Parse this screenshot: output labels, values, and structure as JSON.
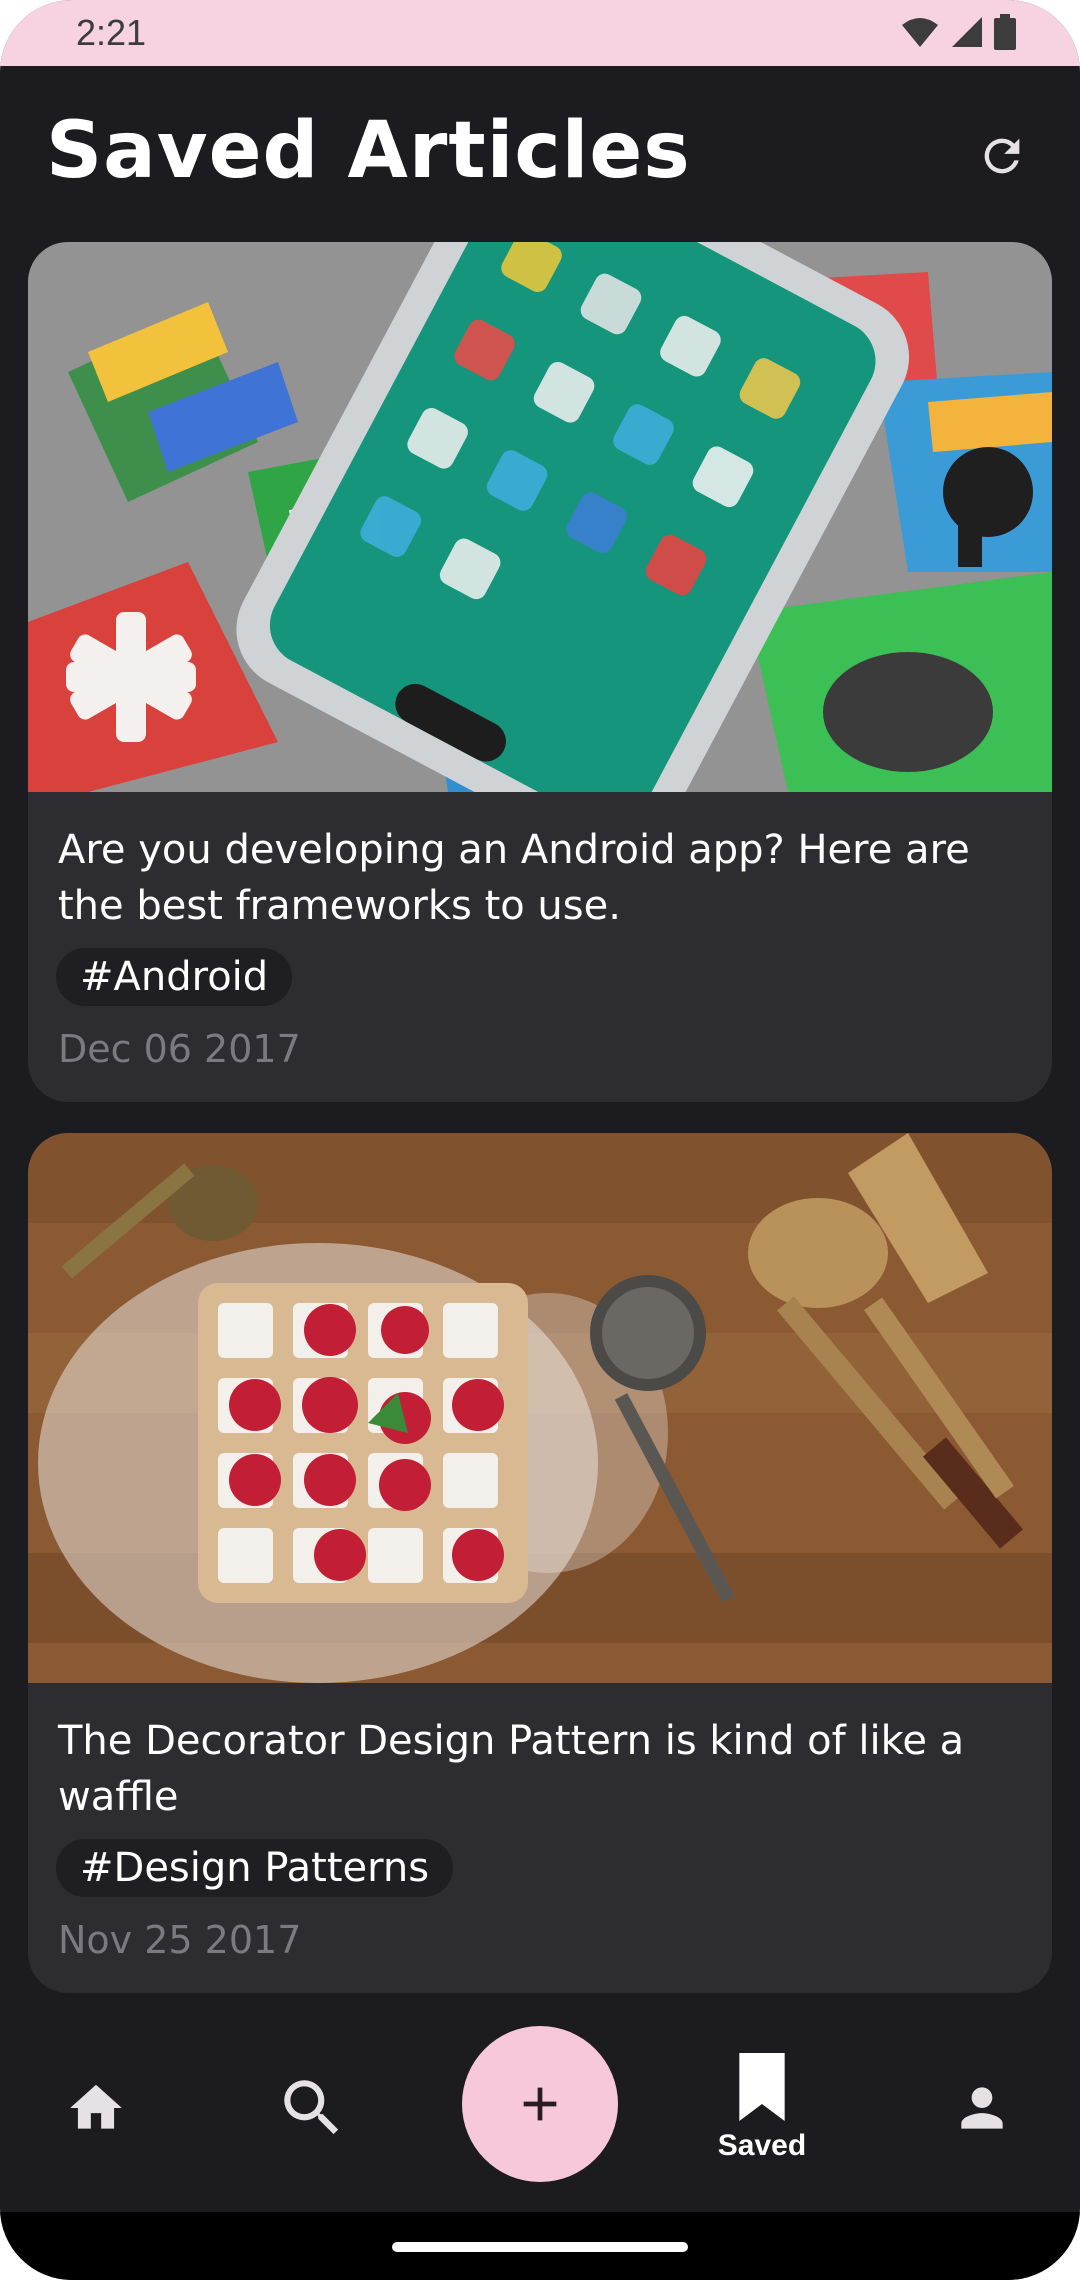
{
  "status_bar": {
    "time": "2:21",
    "icons": [
      "wifi-icon",
      "signal-icon",
      "battery-icon"
    ]
  },
  "header": {
    "title": "Saved Articles",
    "refresh_icon": "refresh-icon"
  },
  "articles": [
    {
      "title": "Are you developing an Android app? Here are the best frameworks to use.",
      "tag": "#Android",
      "date": "Dec 06 2017",
      "image": "smartphone-with-app-icons"
    },
    {
      "title": "The Decorator Design Pattern is kind of like a waffle",
      "tag": "#Design Patterns",
      "date": "Nov 25 2017",
      "image": "waffle-with-raspberries"
    }
  ],
  "bottom_nav": {
    "items": [
      {
        "icon": "home-icon",
        "label": ""
      },
      {
        "icon": "search-icon",
        "label": ""
      },
      {
        "icon": "add-icon",
        "label": ""
      },
      {
        "icon": "bookmark-icon",
        "label": "Saved"
      },
      {
        "icon": "profile-icon",
        "label": ""
      }
    ],
    "active_index": 3
  },
  "colors": {
    "background": "#1c1b1f",
    "card": "#2d2c31",
    "accent": "#f7c8db",
    "status_bar": "#f7d3e1",
    "date_text": "#7b7a80"
  }
}
